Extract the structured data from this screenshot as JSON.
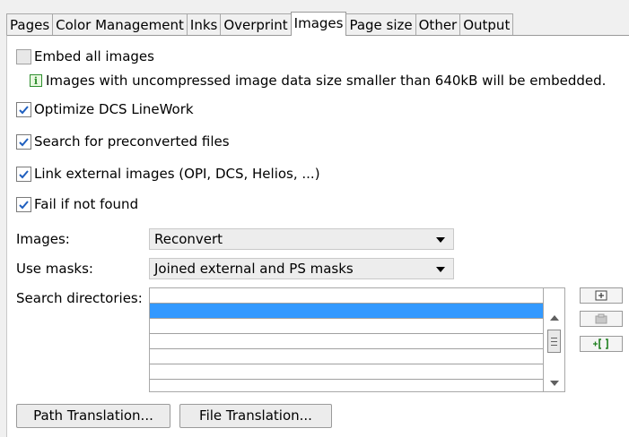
{
  "tabs": [
    {
      "label": "Pages"
    },
    {
      "label": "Color Management"
    },
    {
      "label": "Inks"
    },
    {
      "label": "Overprint"
    },
    {
      "label": "Images",
      "active": true
    },
    {
      "label": "Page size"
    },
    {
      "label": "Other"
    },
    {
      "label": "Output"
    }
  ],
  "options": {
    "embed_all": {
      "label": "Embed all images",
      "checked": false
    },
    "info_text": "Images with uncompressed image data size smaller than 640kB will be embedded.",
    "optimize_dcs": {
      "label": "Optimize DCS LineWork",
      "checked": true
    },
    "search_preconverted": {
      "label": "Search for preconverted files",
      "checked": true
    },
    "link_external": {
      "label": "Link external images (OPI, DCS, Helios, ...)",
      "checked": true
    },
    "fail_not_found": {
      "label": "Fail if not found",
      "checked": true
    }
  },
  "images": {
    "label": "Images:",
    "value": "Reconvert"
  },
  "use_masks": {
    "label": "Use masks:",
    "value": "Joined external and PS masks"
  },
  "search_directories": {
    "label": "Search directories:",
    "rows": [
      "",
      "",
      "",
      "",
      "",
      ""
    ],
    "selected_index": 1
  },
  "side_buttons": [
    {
      "icon": "add-directory-icon"
    },
    {
      "icon": "remove-directory-icon"
    },
    {
      "icon": "add-bracket-icon"
    }
  ],
  "buttons": {
    "path_translation": "Path Translation...",
    "file_translation": "File Translation..."
  },
  "colors": {
    "check": "#1f5fbf",
    "selection": "#3399ff",
    "info": "#2f8f2f"
  }
}
